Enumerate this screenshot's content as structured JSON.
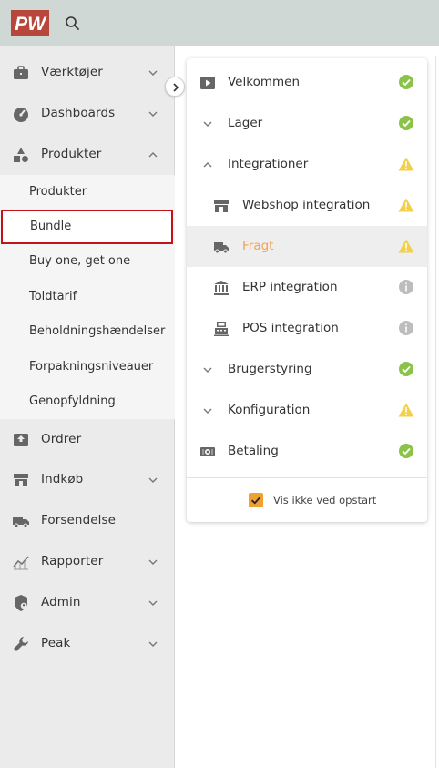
{
  "app": {
    "logo_text": "PW"
  },
  "sidebar": {
    "items": [
      {
        "label": "Værktøjer",
        "icon": "briefcase-icon",
        "expanded": false
      },
      {
        "label": "Dashboards",
        "icon": "speedometer-icon",
        "expanded": false
      },
      {
        "label": "Produkter",
        "icon": "shapes-icon",
        "expanded": true
      },
      {
        "label": "Ordrer",
        "icon": "inbox-upload-icon"
      },
      {
        "label": "Indkøb",
        "icon": "store-icon",
        "expanded": false
      },
      {
        "label": "Forsendelse",
        "icon": "truck-icon"
      },
      {
        "label": "Rapporter",
        "icon": "chart-line-icon",
        "expanded": false
      },
      {
        "label": "Admin",
        "icon": "shield-person-icon",
        "expanded": false
      },
      {
        "label": "Peak",
        "icon": "wrench-icon",
        "expanded": false
      }
    ],
    "produkter_sub": [
      {
        "label": "Produkter"
      },
      {
        "label": "Bundle",
        "selected": true
      },
      {
        "label": "Buy one, get one"
      },
      {
        "label": "Toldtarif"
      },
      {
        "label": "Beholdningshændelser"
      },
      {
        "label": "Forpakningsniveauer"
      },
      {
        "label": "Genopfyldning"
      }
    ]
  },
  "setup": {
    "steps": [
      {
        "label": "Velkommen",
        "icon": "play-icon",
        "status": "ok"
      },
      {
        "label": "Lager",
        "icon": "chevron-down-icon",
        "status": "ok"
      },
      {
        "label": "Integrationer",
        "icon": "chevron-up-icon",
        "status": "warning"
      },
      {
        "label": "Webshop integration",
        "icon": "store-icon",
        "status": "warning"
      },
      {
        "label": "Fragt",
        "icon": "truck-icon",
        "status": "warning",
        "active": true
      },
      {
        "label": "ERP integration",
        "icon": "bank-icon",
        "status": "info"
      },
      {
        "label": "POS integration",
        "icon": "register-icon",
        "status": "info"
      },
      {
        "label": "Brugerstyring",
        "icon": "chevron-down-icon",
        "status": "ok"
      },
      {
        "label": "Konfiguration",
        "icon": "chevron-down-icon",
        "status": "warning"
      },
      {
        "label": "Betaling",
        "icon": "cash-icon",
        "status": "ok"
      }
    ],
    "hide_on_startup_label": "Vis ikke ved opstart",
    "hide_on_startup_checked": true
  },
  "colors": {
    "brand": "#b6473a",
    "topbar": "#cfd8d5",
    "ok": "#8bc34a",
    "warning": "#f2d04a",
    "info": "#bdbdbd",
    "active_text": "#f5a24b",
    "selection_border": "#c0141c",
    "checkbox": "#f0a030"
  }
}
